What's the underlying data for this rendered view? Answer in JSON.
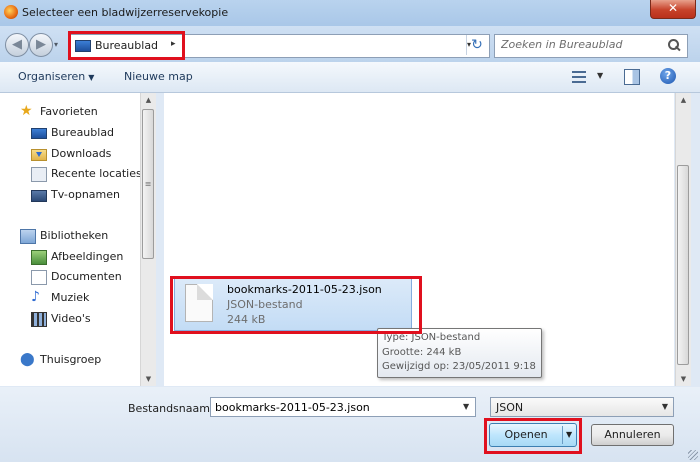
{
  "window": {
    "title": "Selecteer een bladwijzerreservekopie",
    "close_glyph": "✕"
  },
  "navigation": {
    "back_glyph": "◀",
    "forward_glyph": "▶",
    "address": {
      "crumb": "Bureaublad",
      "crumb_arrow": "▸",
      "dropdown_glyph": "▾"
    },
    "refresh_glyph": "↻",
    "search": {
      "placeholder": "Zoeken in Bureaublad"
    }
  },
  "toolbar": {
    "organize_label": "Organiseren",
    "organize_caret": "▼",
    "new_folder_label": "Nieuwe map",
    "view_dropdown_glyph": "▼",
    "help_glyph": "?"
  },
  "sidebar": {
    "favorites_header": "Favorieten",
    "favorites": [
      {
        "label": "Bureaublad",
        "icon": "desktop-icon"
      },
      {
        "label": "Downloads",
        "icon": "downloads-icon"
      },
      {
        "label": "Recente locaties",
        "icon": "recent-places-icon"
      },
      {
        "label": "Tv-opnamen",
        "icon": "tv-recordings-icon"
      }
    ],
    "libraries_header": "Bibliotheken",
    "libraries": [
      {
        "label": "Afbeeldingen",
        "icon": "pictures-icon"
      },
      {
        "label": "Documenten",
        "icon": "documents-icon"
      },
      {
        "label": "Muziek",
        "icon": "music-icon"
      },
      {
        "label": "Video's",
        "icon": "videos-icon"
      }
    ],
    "homegroup": "Thuisgroep"
  },
  "file": {
    "name": "bookmarks-2011-05-23.json",
    "type": "JSON-bestand",
    "size": "244 kB",
    "selected": true
  },
  "tooltip": {
    "type": "Type: JSON-bestand",
    "size": "Grootte: 244 kB",
    "modified": "Gewijzigd op: 23/05/2011 9:18"
  },
  "footer": {
    "filename_label": "Bestandsnaam:",
    "filename_value": "bookmarks-2011-05-23.json",
    "filename_dropdown_glyph": "▼",
    "filetype_value": "JSON",
    "filetype_dropdown_glyph": "▼",
    "open_label": "Openen",
    "open_arrow": "▼",
    "cancel_label": "Annuleren"
  },
  "scroll": {
    "up_glyph": "▲",
    "down_glyph": "▼",
    "grip_glyph": "≡"
  },
  "colors": {
    "highlight_box": "#e0101e",
    "selection": "#c3dcf5",
    "window_frame": "#b9d3ee"
  }
}
